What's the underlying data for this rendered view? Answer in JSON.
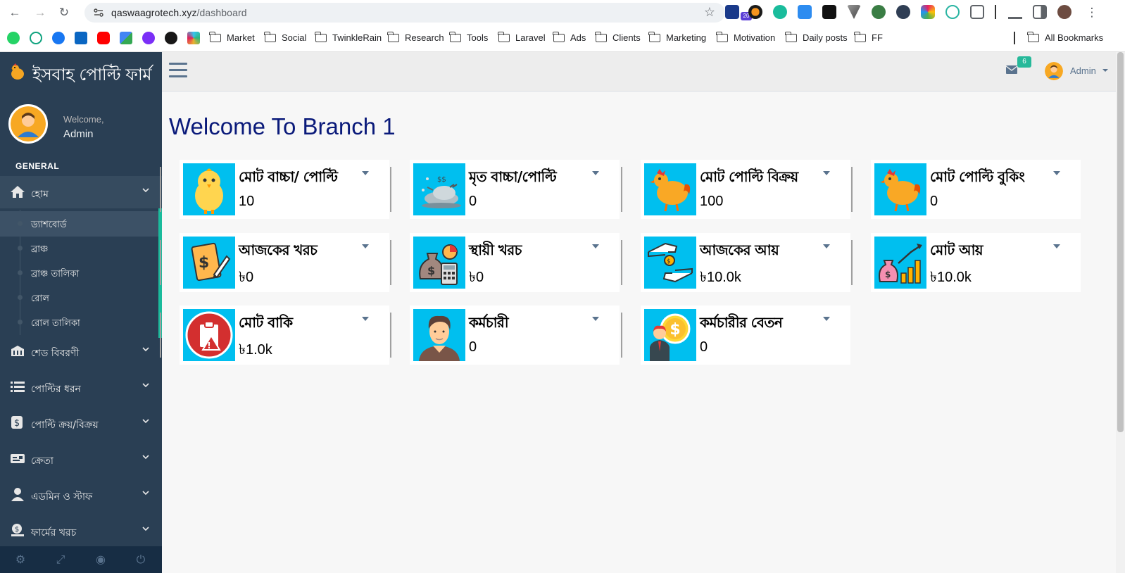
{
  "browser": {
    "url_domain": "qaswaagrotech.xyz",
    "url_path": "/dashboard",
    "extension_badge": "20",
    "bookmark_folders": [
      "Market",
      "Social",
      "TwinkleRain",
      "Research",
      "Tools",
      "Laravel",
      "Ads",
      "Clients",
      "Marketing",
      "Motivation",
      "Daily posts",
      "FF"
    ],
    "all_bookmarks": "All Bookmarks"
  },
  "sidebar": {
    "brand": "ইসবাহ পোল্টি ফার্ম",
    "welcome": "Welcome,",
    "user": "Admin",
    "section": "GENERAL",
    "home": "হোম",
    "sub_items": [
      "ড্যাশবোর্ড",
      "ব্রাঞ্চ",
      "ব্রাঞ্চ তালিকা",
      "রোল",
      "রোল তালিকা"
    ],
    "menu": [
      "শেড বিবরণী",
      "পোল্টির ধরন",
      "পোল্টি ক্রয়/বিক্রয়",
      "ক্রেতা",
      "এডমিন ও স্টাফ",
      "ফার্মের খরচ"
    ]
  },
  "topnav": {
    "mail_count": "6",
    "user": "Admin"
  },
  "main": {
    "title": "Welcome To Branch 1",
    "cards": [
      {
        "title": "মোট বাচ্চা/ পোল্টি",
        "value": "10"
      },
      {
        "title": "মৃত বাচ্চা/পোল্টি",
        "value": "0"
      },
      {
        "title": "মোট পোল্টি বিক্রয়",
        "value": "100"
      },
      {
        "title": "মোট পোল্টি বুকিং",
        "value": "0"
      },
      {
        "title": "আজকের খরচ",
        "value": "৳0"
      },
      {
        "title": "স্থায়ী খরচ",
        "value": "৳0"
      },
      {
        "title": "আজকের আয়",
        "value": "৳10.0k"
      },
      {
        "title": "মোট আয়",
        "value": "৳10.0k"
      },
      {
        "title": "মোট বাকি",
        "value": "৳1.0k"
      },
      {
        "title": "কর্মচারী",
        "value": "0"
      },
      {
        "title": "কর্মচারীর বেতন",
        "value": "0"
      }
    ]
  },
  "colors": {
    "sidebar": "#2a3f54",
    "accent": "#1abb9c",
    "card_icon_bg": "#00bfef",
    "title": "#0a1a7a"
  }
}
